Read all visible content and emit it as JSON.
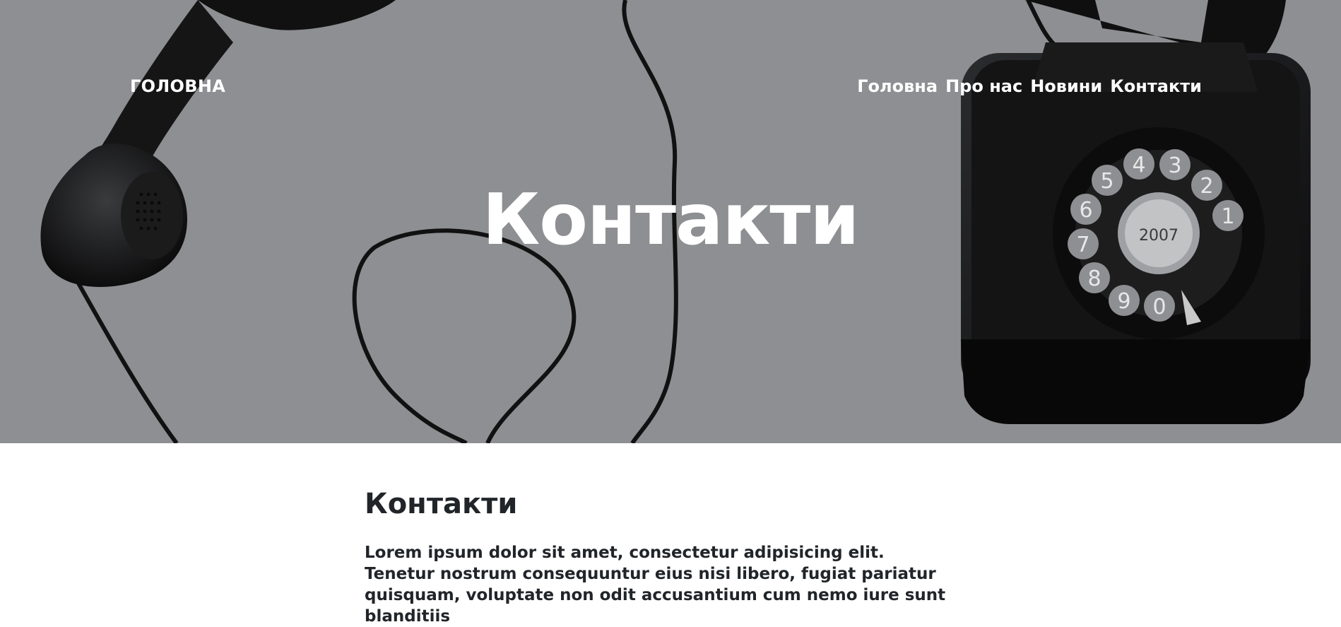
{
  "header": {
    "brand": "ГОЛОВНА",
    "nav": [
      {
        "label": "Головна"
      },
      {
        "label": "Про нас"
      },
      {
        "label": "Новини"
      },
      {
        "label": "Контакти"
      }
    ]
  },
  "hero": {
    "title": "Контакти",
    "overlay_color": "#8e8f92"
  },
  "main": {
    "heading": "Контакти",
    "paragraph": "Lorem ipsum dolor sit amet, consectetur adipisicing elit. Tenetur nostrum consequuntur eius nisi libero, fugiat pariatur quisquam, voluptate non odit accusantium cum nemo iure sunt blanditiis"
  },
  "rotary_dial": {
    "digits": [
      "1",
      "2",
      "3",
      "4",
      "5",
      "6",
      "7",
      "8",
      "9",
      "0"
    ],
    "center_year": "2007"
  }
}
